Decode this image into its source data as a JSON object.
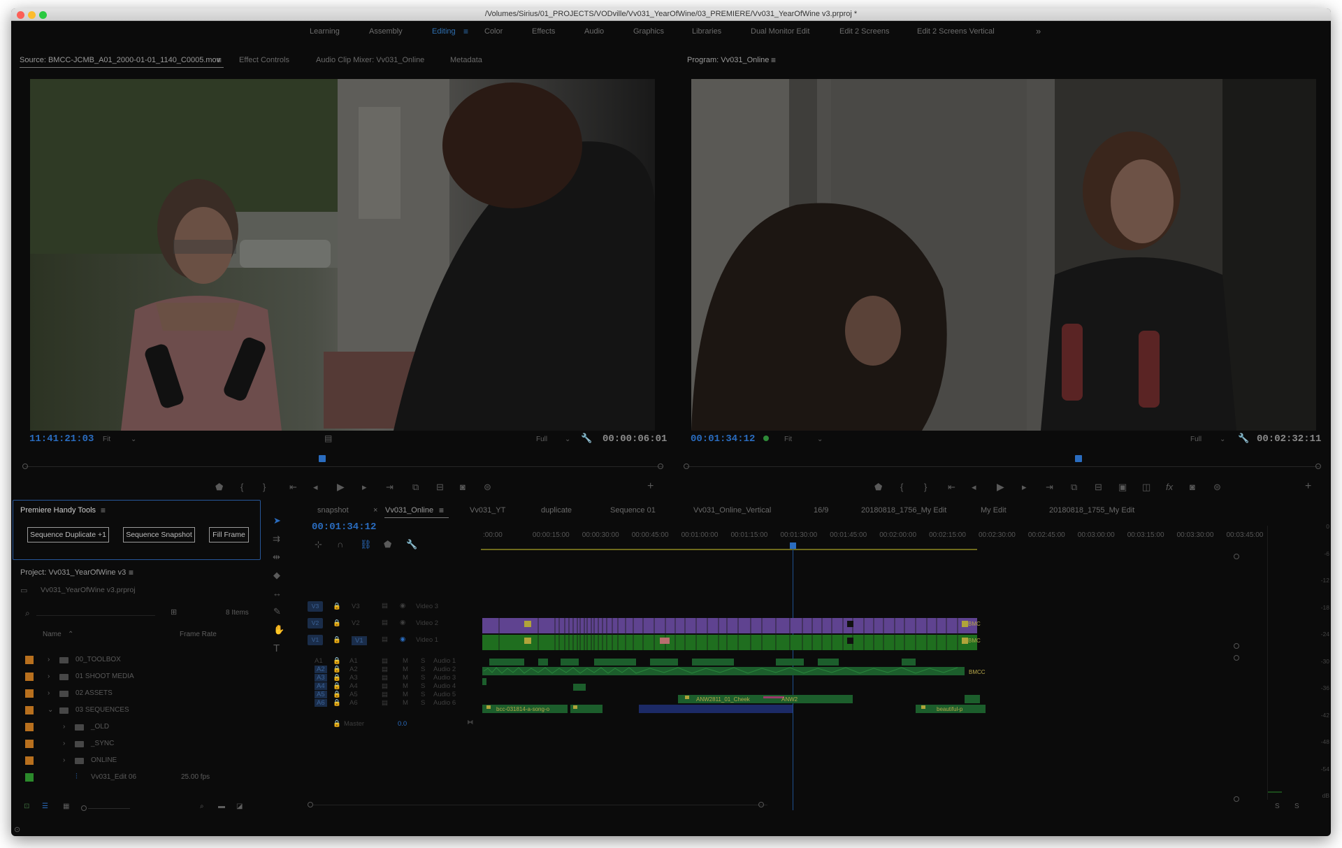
{
  "window": {
    "title": "/Volumes/Sirius/01_PROJECTS/VODville/Vv031_YearOfWine/03_PREMIERE/Vv031_YearOfWine v3.prproj *"
  },
  "workspaces": {
    "items": [
      "Learning",
      "Assembly",
      "Editing",
      "Color",
      "Effects",
      "Audio",
      "Graphics",
      "Libraries",
      "Dual Monitor Edit",
      "Edit 2 Screens",
      "Edit 2 Screens Vertical"
    ],
    "active": "Editing",
    "overflow_icon": "double-chevron-right-icon"
  },
  "source_panel": {
    "tabs": [
      "Source: BMCC-JCMB_A01_2000-01-01_1140_C0005.mov",
      "Effect Controls",
      "Audio Clip Mixer: Vv031_Online",
      "Metadata"
    ],
    "timecode_left": "11:41:21:03",
    "zoom": "Fit",
    "quality": "Full",
    "timecode_right": "00:00:06:01"
  },
  "program_panel": {
    "tab": "Program: Vv031_Online",
    "timecode_left": "00:01:34:12",
    "zoom": "Fit",
    "quality": "Full",
    "timecode_right": "00:02:32:11"
  },
  "handy_tools": {
    "title": "Premiere Handy Tools",
    "buttons": [
      "Sequence Duplicate +1",
      "Sequence Snapshot",
      "Fill Frame"
    ]
  },
  "project_panel": {
    "tab": "Project: Vv031_YearOfWine v3",
    "file": "Vv031_YearOfWine v3.prproj",
    "item_count": "8 Items",
    "col_name": "Name",
    "col_rate": "Frame Rate",
    "rows": [
      {
        "name": "00_TOOLBOX",
        "rate": "",
        "color": "#b8701e",
        "kind": "bin"
      },
      {
        "name": "01 SHOOT MEDIA",
        "rate": "",
        "color": "#b8701e",
        "kind": "bin"
      },
      {
        "name": "02 ASSETS",
        "rate": "",
        "color": "#b8701e",
        "kind": "bin"
      },
      {
        "name": "03 SEQUENCES",
        "rate": "",
        "color": "#b8701e",
        "kind": "bin"
      },
      {
        "name": "_OLD",
        "rate": "",
        "color": "#b8701e",
        "kind": "bin"
      },
      {
        "name": "_SYNC",
        "rate": "",
        "color": "#b8701e",
        "kind": "bin"
      },
      {
        "name": "ONLINE",
        "rate": "",
        "color": "#b8701e",
        "kind": "bin"
      },
      {
        "name": "Vv031_Edit 06",
        "rate": "25.00 fps",
        "color": "#2b8a2b",
        "kind": "sequence"
      }
    ]
  },
  "timeline": {
    "tabs": [
      "snapshot",
      "Vv031_Online",
      "Vv031_YT",
      "duplicate",
      "Sequence 01",
      "Vv031_Online_Vertical",
      "16/9",
      "20180818_1756_My Edit",
      "My Edit",
      "20180818_1755_My Edit"
    ],
    "active_tab": "Vv031_Online",
    "timecode": "00:01:34:12",
    "ruler": [
      ":00:00",
      "00:00:15:00",
      "00:00:30:00",
      "00:00:45:00",
      "00:01:00:00",
      "00:01:15:00",
      "00:01:30:00",
      "00:01:45:00",
      "00:02:00:00",
      "00:02:15:00",
      "00:02:30:00",
      "00:02:45:00",
      "00:03:00:00",
      "00:03:15:00",
      "00:03:30:00",
      "00:03:45:00"
    ],
    "video_tracks": [
      {
        "id": "V3",
        "name": "Video 3"
      },
      {
        "id": "V2",
        "name": "Video 2"
      },
      {
        "id": "V1",
        "name": "Video 1"
      }
    ],
    "audio_tracks": [
      {
        "id": "A1",
        "name": "Audio 1"
      },
      {
        "id": "A2",
        "name": "Audio 2"
      },
      {
        "id": "A3",
        "name": "Audio 3"
      },
      {
        "id": "A4",
        "name": "Audio 4"
      },
      {
        "id": "A5",
        "name": "Audio 5"
      },
      {
        "id": "A6",
        "name": "Audio 6"
      }
    ],
    "master": {
      "label": "Master",
      "value": "0.0"
    },
    "clip_labels": [
      "BMC",
      "BMC",
      "BMCC",
      "ANW2811_01_Cheek",
      "ANW2",
      "bcc-031814-a-song-o",
      "beautiful-p"
    ]
  },
  "meter": {
    "scale": [
      "0",
      "-6",
      "-12",
      "-18",
      "-24",
      "-30",
      "-36",
      "-42",
      "-48",
      "-54",
      "dB"
    ],
    "solo": [
      "S",
      "S"
    ]
  },
  "colors": {
    "accent": "#2f6fb0",
    "video_purple": "#7d58b8",
    "video_green": "#2b8c2b",
    "audio_green": "#1f7a32"
  }
}
